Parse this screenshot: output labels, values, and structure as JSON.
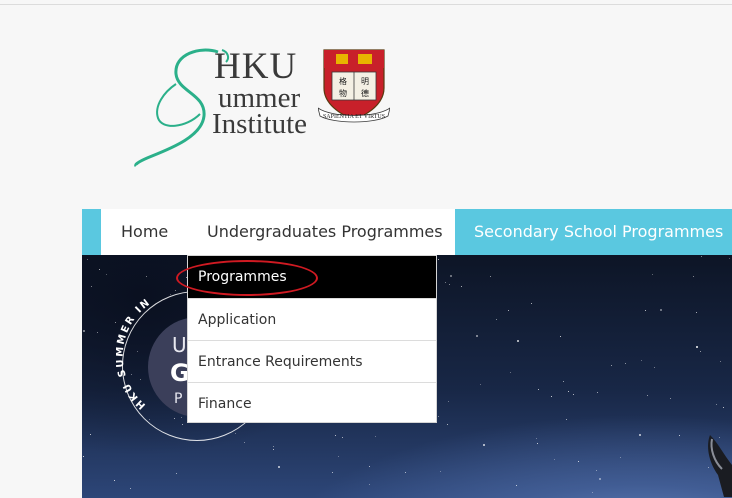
{
  "logo": {
    "line1": "HKU",
    "line2": "ummer",
    "line3": "Institute",
    "crest_motto": "SAPIENTIA ET VIRTUS",
    "crest_characters": "格物 明德",
    "colors": {
      "swash": "#2bb08a",
      "text": "#3a3a3a",
      "crest_red": "#c8202a",
      "crest_gold": "#e8b400"
    }
  },
  "nav": {
    "items": [
      {
        "label": "Home"
      },
      {
        "label": "Undergraduates Programmes"
      },
      {
        "label": "Secondary School Programmes",
        "active_color": "#5ac8e0"
      }
    ]
  },
  "dropdown": {
    "items": [
      {
        "label": "Programmes",
        "highlighted": true
      },
      {
        "label": "Application"
      },
      {
        "label": "Entrance Requirements"
      },
      {
        "label": "Finance"
      }
    ],
    "annotation_color": "#d01a22"
  },
  "hero": {
    "badge_arc_text": "HKU SUMMER IN",
    "badge_letters": [
      "U",
      "G",
      "P"
    ]
  }
}
